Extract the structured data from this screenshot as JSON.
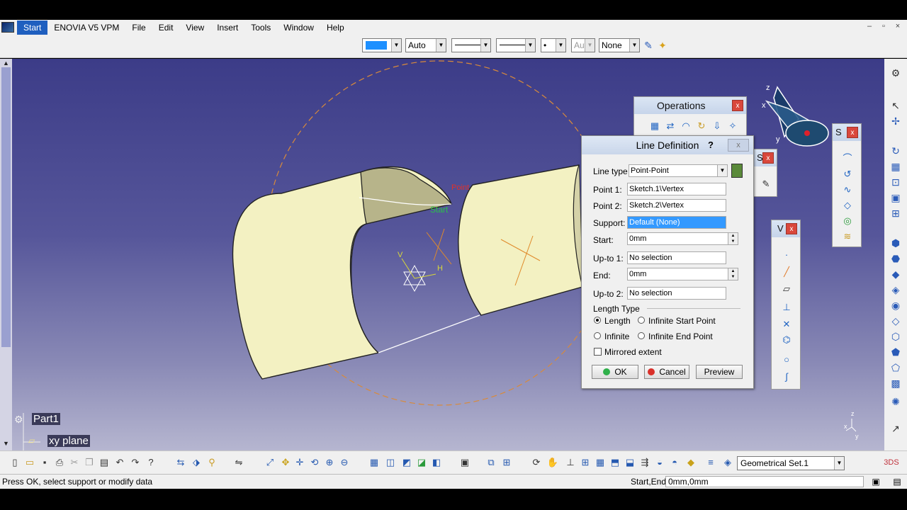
{
  "menubar": {
    "items": [
      "Start",
      "ENOVIA V5 VPM",
      "File",
      "Edit",
      "View",
      "Insert",
      "Tools",
      "Window",
      "Help"
    ],
    "window_buttons": [
      "–",
      "▫",
      "×"
    ]
  },
  "graphic_properties": {
    "color": "#1e90ff",
    "transparency": "Auto",
    "layer_disabled": "Aut",
    "layer": "None",
    "point_symbol": "•"
  },
  "tree": {
    "root": "Part1",
    "selected": "xy plane"
  },
  "viewport_labels": {
    "start": "Start",
    "end": "Point",
    "axis_h": "H",
    "axis_v": "V",
    "compass_x": "x",
    "compass_y": "y",
    "compass_z": "z",
    "axis_corner_x": "x",
    "axis_corner_y": "y",
    "axis_corner_z": "z"
  },
  "operations_toolbar": {
    "title": "Operations",
    "close": "x"
  },
  "small_toolbars": {
    "s1": "S",
    "s2": "S",
    "v1": "V",
    "close": "x"
  },
  "dialog": {
    "title": "Line Definition",
    "help": "?",
    "close": "x",
    "line_type_label": "Line type :",
    "line_type_value": "Point-Point",
    "point1_label": "Point 1:",
    "point1_value": "Sketch.1\\Vertex",
    "point2_label": "Point 2:",
    "point2_value": "Sketch.2\\Vertex",
    "support_label": "Support:",
    "support_value": "Default (None)",
    "start_label": "Start:",
    "start_value": "0mm",
    "upto1_label": "Up-to 1:",
    "upto1_value": "No selection",
    "end_label": "End:",
    "end_value": "0mm",
    "upto2_label": "Up-to 2:",
    "upto2_value": "No selection",
    "length_type_label": "Length Type",
    "radio_length": "Length",
    "radio_infinite_start": "Infinite Start Point",
    "radio_infinite": "Infinite",
    "radio_infinite_end": "Infinite End Point",
    "mirrored_label": "Mirrored extent",
    "ok_label": "OK",
    "cancel_label": "Cancel",
    "preview_label": "Preview"
  },
  "bottom_toolbar": {
    "geometrical_set": "Geometrical Set.1"
  },
  "statusbar": {
    "message": "Press OK, select support or modify data",
    "field_label": "Start,End",
    "field_value": "0mm,0mm"
  }
}
